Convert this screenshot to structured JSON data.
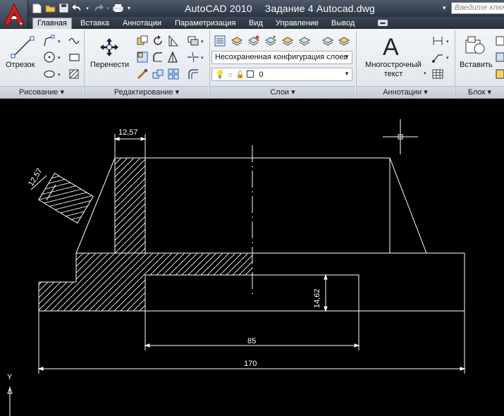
{
  "window": {
    "app_name": "AutoCAD 2010",
    "document": "Задание 4 Autocad.dwg",
    "search_placeholder": "Введите ключ"
  },
  "tabs": [
    {
      "label": "Главная",
      "active": true
    },
    {
      "label": "Вставка"
    },
    {
      "label": "Аннотации"
    },
    {
      "label": "Параметризация"
    },
    {
      "label": "Вид"
    },
    {
      "label": "Управление"
    },
    {
      "label": "Вывод"
    }
  ],
  "ribbon": {
    "draw": {
      "line_label": "Отрезок",
      "panel_title": "Рисование"
    },
    "modify": {
      "move_label": "Перенести",
      "panel_title": "Редактирование"
    },
    "layers": {
      "layer_state": "Несохраненная конфигурация слоев",
      "current_layer": "0",
      "panel_title": "Слои"
    },
    "annotation": {
      "mtext_label_1": "Многострочный",
      "mtext_label_2": "текст",
      "panel_title": "Аннотации"
    },
    "block": {
      "insert_label": "Вставить",
      "panel_title": "Блок"
    }
  },
  "drawing": {
    "dimensions": {
      "top_width": "12,57",
      "section_width": "12,57",
      "height": "14,62",
      "inner_length": "85",
      "overall_length": "170"
    },
    "ucs_axis_label": "Y"
  },
  "colors": {
    "canvas": "#000000",
    "geometry": "#ffffff",
    "accent_logo": "#cc1f1f"
  }
}
